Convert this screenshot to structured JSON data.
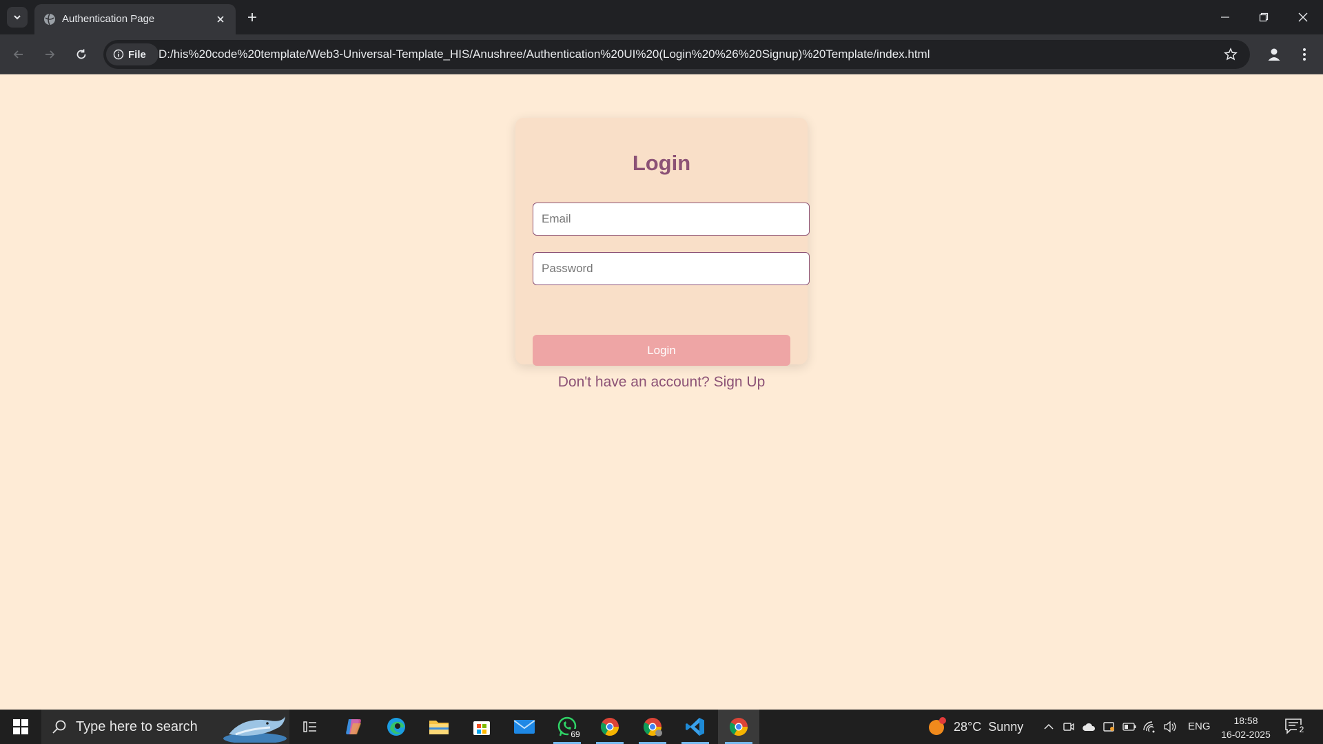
{
  "browser": {
    "tab": {
      "title": "Authentication Page"
    },
    "address": {
      "site_chip_label": "File",
      "url": "D:/his%20code%20template/Web3-Universal-Template_HIS/Anushree/Authentication%20UI%20(Login%20%26%20Signup)%20Template/index.html"
    }
  },
  "page": {
    "title": "Login",
    "email_placeholder": "Email",
    "password_placeholder": "Password",
    "login_button": "Login",
    "switch_prompt": "Don't have an account?",
    "switch_link": "Sign Up",
    "colors": {
      "background": "#feebd6",
      "card": "#f9dfc8",
      "accent": "#8c5276",
      "button": "#eea5a5"
    }
  },
  "taskbar": {
    "search_placeholder": "Type here to search",
    "apps": [
      "task-view",
      "copilot",
      "edge",
      "file-explorer",
      "microsoft-store",
      "mail",
      "whatsapp",
      "chrome-profile-a",
      "chrome-profile-b",
      "vscode",
      "chrome"
    ],
    "whatsapp_badge": "69",
    "weather": {
      "temp": "28°C",
      "condition": "Sunny",
      "alert_count": "1"
    },
    "language": "ENG",
    "time": "18:58",
    "date": "16-02-2025",
    "notification_count": "2"
  }
}
